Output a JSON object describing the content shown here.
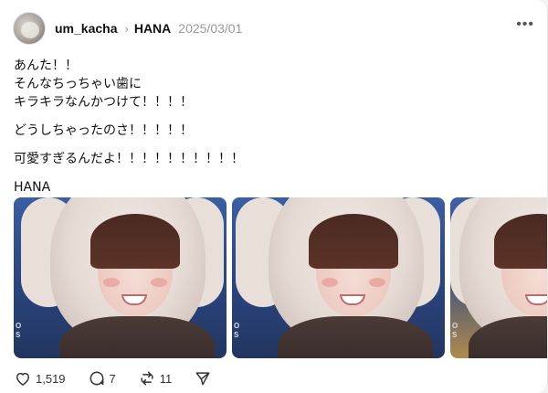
{
  "post": {
    "author": "um_kacha",
    "topic": "HANA",
    "date": "2025/03/01",
    "more_label": "•••",
    "chevron": "›",
    "paragraphs": [
      "あんた！！\nそんなちっちゃい歯に\nキラキラなんかつけて！！！！",
      "どうしちゃったのさ！！！！！",
      "可愛すぎるんだよ！！！！！！！！！！",
      "HANA"
    ]
  },
  "media": {
    "watermark": "O S"
  },
  "actions": {
    "like_count": "1,519",
    "reply_count": "7",
    "repost_count": "11"
  },
  "icons": {
    "like": "heart-icon",
    "reply": "comment-icon",
    "repost": "repost-icon",
    "share": "send-icon",
    "more": "more-icon"
  }
}
